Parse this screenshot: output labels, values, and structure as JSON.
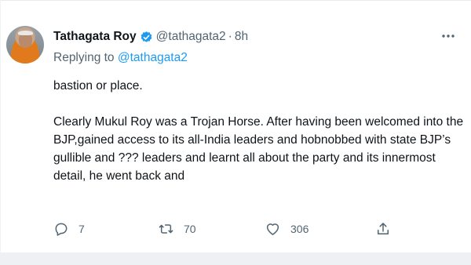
{
  "tweet": {
    "author_name": "Tathagata Roy",
    "author_handle": "@tathagata2",
    "separator": "·",
    "time": "8h",
    "replying_prefix": "Replying to",
    "replying_to": "@tathagata2",
    "text_line1": "bastion or place.",
    "text_paragraph2": "Clearly Mukul Roy was a Trojan Horse. After having been welcomed into the BJP,gained access to its all-India leaders and hobnobbed with state BJP’s gullible and ??? leaders and learnt all about the party and its innermost detail, he went back and"
  },
  "actions": {
    "reply_count": "7",
    "retweet_count": "70",
    "like_count": "306"
  },
  "icons": {
    "verified": "verified-badge-icon",
    "more": "more-horizontal-icon",
    "reply": "reply-bubble-icon",
    "retweet": "retweet-icon",
    "like": "heart-icon",
    "share": "share-icon"
  },
  "colors": {
    "accent": "#1d9bf0",
    "secondary_text": "#536471",
    "primary_text": "#0f1419"
  }
}
